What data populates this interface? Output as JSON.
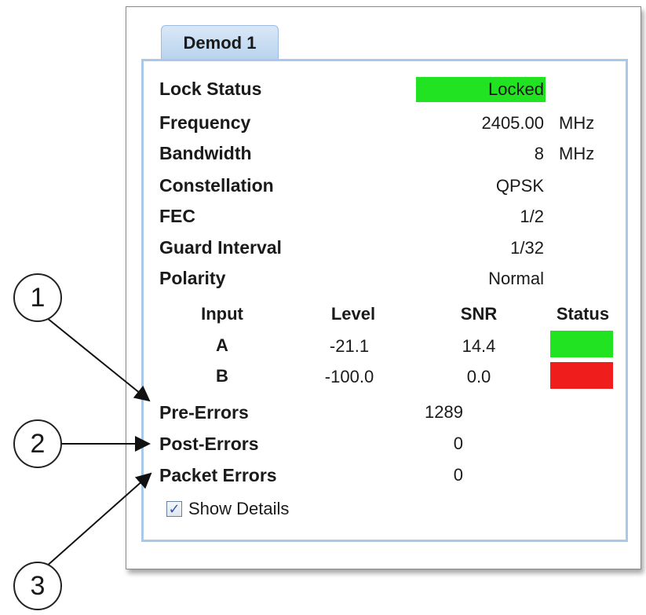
{
  "tab": {
    "label": "Demod 1"
  },
  "fields": {
    "lock_status": {
      "label": "Lock Status",
      "value": "Locked"
    },
    "frequency": {
      "label": "Frequency",
      "value": "2405.00",
      "unit": "MHz"
    },
    "bandwidth": {
      "label": "Bandwidth",
      "value": "8",
      "unit": "MHz"
    },
    "constellation": {
      "label": "Constellation",
      "value": "QPSK"
    },
    "fec": {
      "label": "FEC",
      "value": "1/2"
    },
    "guard_interval": {
      "label": "Guard Interval",
      "value": "1/32"
    },
    "polarity": {
      "label": "Polarity",
      "value": "Normal"
    }
  },
  "input_table": {
    "headers": {
      "input": "Input",
      "level": "Level",
      "snr": "SNR",
      "status": "Status"
    },
    "rows": [
      {
        "input": "A",
        "level": "-21.1",
        "snr": "14.4",
        "status_color": "#22e322"
      },
      {
        "input": "B",
        "level": "-100.0",
        "snr": "0.0",
        "status_color": "#f01d1d"
      }
    ]
  },
  "errors": {
    "pre": {
      "label": "Pre-Errors",
      "value": "1289"
    },
    "post": {
      "label": "Post-Errors",
      "value": "0"
    },
    "packet": {
      "label": "Packet Errors",
      "value": "0"
    }
  },
  "show_details": {
    "label": "Show Details",
    "checked": true
  },
  "callouts": [
    "1",
    "2",
    "3"
  ],
  "colors": {
    "locked": "#22e322",
    "ok": "#22e322",
    "fail": "#f01d1d",
    "tab": "#b9d3ee",
    "panel_border": "#a9c9ea"
  }
}
